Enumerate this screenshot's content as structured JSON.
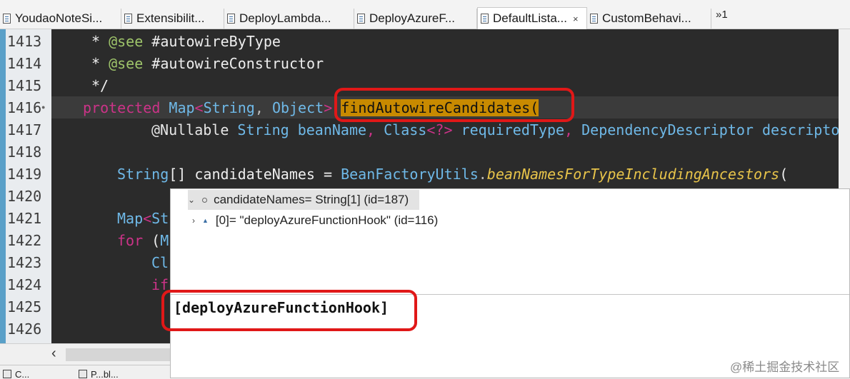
{
  "tabs": [
    {
      "label": "YoudaoNoteSi..."
    },
    {
      "label": "Extensibilit..."
    },
    {
      "label": "DeployLambda..."
    },
    {
      "label": "DeployAzureF..."
    },
    {
      "label": "DefaultLista...",
      "close": "×"
    },
    {
      "label": "CustomBehavi..."
    }
  ],
  "tab_overflow": "»1",
  "editor": {
    "line_numbers": [
      "1413",
      "1414",
      "1415",
      "1416",
      "1417",
      "1418",
      "1419",
      "1420",
      "1421",
      "1422",
      "1423",
      "1424",
      "1425",
      "1426"
    ],
    "lines": {
      "l1413": {
        "star": "* ",
        "tag": "@see",
        "rest": " #autowireByType"
      },
      "l1414": {
        "star": "* ",
        "tag": "@see",
        "rest": " #autowireConstructor"
      },
      "l1415": {
        "text": "*/"
      },
      "l1416": {
        "kw": "protected",
        "type1": "Map",
        "lt": "<",
        "type2": "String",
        "comma": ", ",
        "type3": "Object",
        "gt": ">",
        "method": "findAutowireCandidates("
      },
      "l1417": {
        "ann": "@Nullable",
        "t1": "String",
        "p1": "beanName",
        "comma": ",",
        "t2": "Class",
        "gen": "<?>",
        "p2": "requiredType",
        "t3": "DependencyDescriptor",
        "p3": "descripto"
      },
      "l1419": {
        "t1": "String",
        "brackets": "[] candidateNames = ",
        "t2": "BeanFactoryUtils",
        "dot": ".",
        "call": "beanNamesForTypeIncludingAncestors",
        "paren": "("
      },
      "l1421": {
        "t": "Map",
        "rest": "<St"
      },
      "l1422": {
        "kw": "for",
        "rest": " (M"
      },
      "l1423": {
        "rest": "Cl"
      },
      "l1424": {
        "kw": "if"
      }
    }
  },
  "popup": {
    "row1": {
      "twisty": "⌄",
      "text": "candidateNames= String[1]  (id=187)"
    },
    "row2": {
      "twisty": "›",
      "text": "[0]= \"deployAzureFunctionHook\" (id=116)"
    },
    "detail": "[deployAzureFunctionHook]"
  },
  "bottom_tabs": [
    "C...",
    "P...bl..."
  ],
  "watermark": "@稀土掘金技术社区",
  "colors": {
    "highlight_box": "#e01818",
    "selection": "#c88a00",
    "editor_bg": "#2b2b2b"
  }
}
